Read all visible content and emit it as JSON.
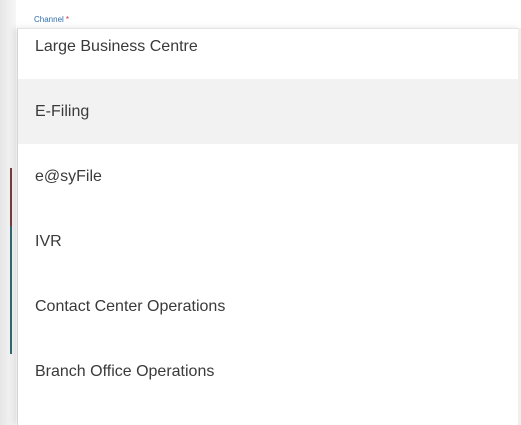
{
  "field": {
    "label": "Channel",
    "required_marker": "*"
  },
  "dropdown": {
    "options": [
      {
        "label": "Large Business Centre",
        "highlighted": false
      },
      {
        "label": "E-Filing",
        "highlighted": true
      },
      {
        "label": "e@syFile",
        "highlighted": false
      },
      {
        "label": "IVR",
        "highlighted": false
      },
      {
        "label": "Contact Center Operations",
        "highlighted": false
      },
      {
        "label": "Branch Office Operations",
        "highlighted": false
      }
    ]
  },
  "colors": {
    "label": "#2f6fb0",
    "required": "#d0312d",
    "option_text": "#3a3a3a",
    "highlight_bg": "#f2f2f2"
  }
}
